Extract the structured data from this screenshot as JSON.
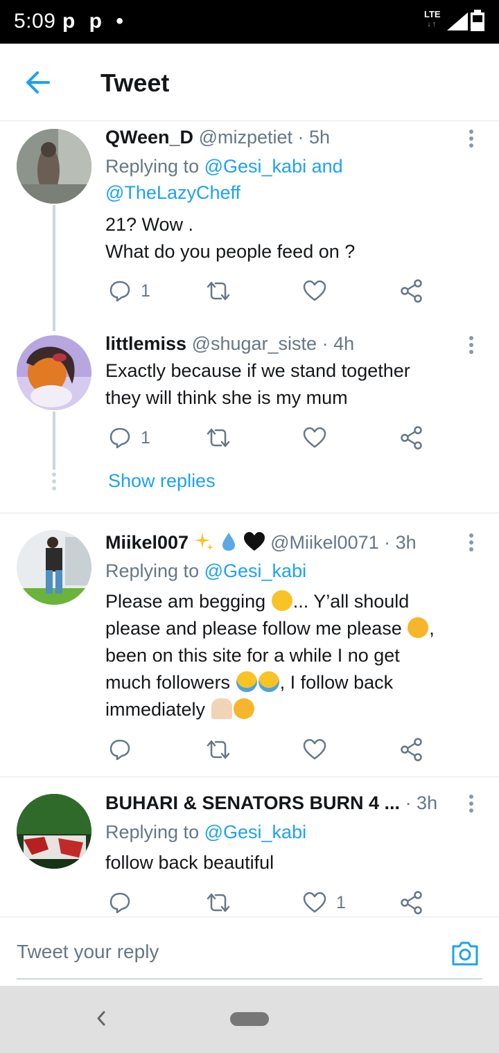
{
  "status_bar": {
    "time": "5:09",
    "notification_icons": "p p •",
    "network": "LTE",
    "network_arrows": "↓↑"
  },
  "header": {
    "title": "Tweet",
    "back_icon": "arrow-left-icon"
  },
  "tweets": [
    {
      "name": "QWeen_D",
      "handle": "@mizpetiet",
      "time": "· 5h",
      "replying_prefix": "Replying to",
      "replying_mentions": "@Gesi_kabi and @TheLazyCheff",
      "text_line1": "21? Wow .",
      "text_line2": "What do you people feed on ?",
      "reply_count": "1",
      "retweet_count": "",
      "like_count": ""
    },
    {
      "name": "littlemiss",
      "handle": "@shugar_siste",
      "time": "· 4h",
      "text_line1": "Exactly because if we stand together",
      "text_line2": "they will think she is my mum",
      "reply_count": "1",
      "retweet_count": "",
      "like_count": "",
      "show_replies": "Show replies"
    },
    {
      "name": "Miikel007",
      "name_emojis": [
        "sparkles",
        "droplet",
        "black-heart"
      ],
      "handle": "@Miikel0071",
      "time": "· 3h",
      "replying_prefix": "Replying to",
      "replying_mentions": "@Gesi_kabi",
      "text_line1": "Please am begging",
      "text_line1_tail": "... Y’all should",
      "text_line2": "please and please follow me please",
      "text_line2_tail": ",",
      "text_line3": "been on this site for a while I no get",
      "text_line4": "much followers",
      "text_line4_tail": ", I follow back",
      "text_line5": "immediately",
      "reply_count": "",
      "retweet_count": "",
      "like_count": ""
    },
    {
      "name": "BUHARI & SENATORS BURN 4 ...",
      "handle": "",
      "time": "· 3h",
      "replying_prefix": "Replying to",
      "replying_mentions": "@Gesi_kabi",
      "text_line1": "follow back beautiful",
      "reply_count": "",
      "retweet_count": "",
      "like_count": "1"
    }
  ],
  "composer": {
    "placeholder": "Tweet your reply",
    "camera_icon": "camera-icon"
  },
  "colors": {
    "accent": "#1da1f2",
    "secondary_text": "#657786",
    "primary_text": "#14171a",
    "divider": "#e1e8ed"
  }
}
